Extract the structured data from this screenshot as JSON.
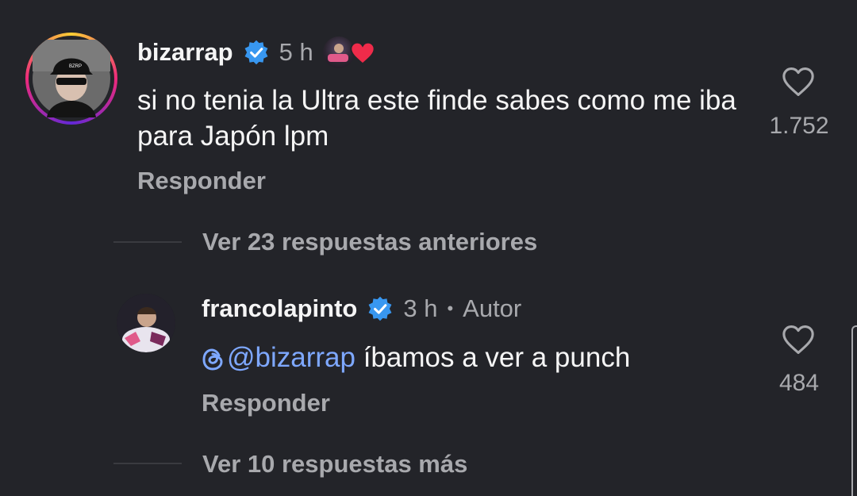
{
  "comment1": {
    "username": "bizarrap",
    "time": "5 h",
    "text": "si no tenia la Ultra este finde sabes como me iba para Japón lpm",
    "reply_label": "Responder",
    "likes": "1.752"
  },
  "thread": {
    "more_previous_label": "Ver 23 respuestas anteriores"
  },
  "comment2": {
    "username": "francolapinto",
    "time": "3 h",
    "separator": "•",
    "author_label": "Autor",
    "mention": "@bizarrap",
    "text": " íbamos a ver a punch",
    "reply_label": "Responder",
    "likes": "484"
  },
  "footer": {
    "more_label": "Ver 10 respuestas más"
  },
  "colors": {
    "background": "#232429",
    "verified": "#3897f0",
    "mention": "#7ea8ff",
    "heart": "#ef2b4a",
    "muted": "#a8a9ad"
  },
  "icons": [
    "verified-badge-icon",
    "heart-outline-icon",
    "liked-by-author-heart-icon",
    "threads-logo-icon"
  ]
}
